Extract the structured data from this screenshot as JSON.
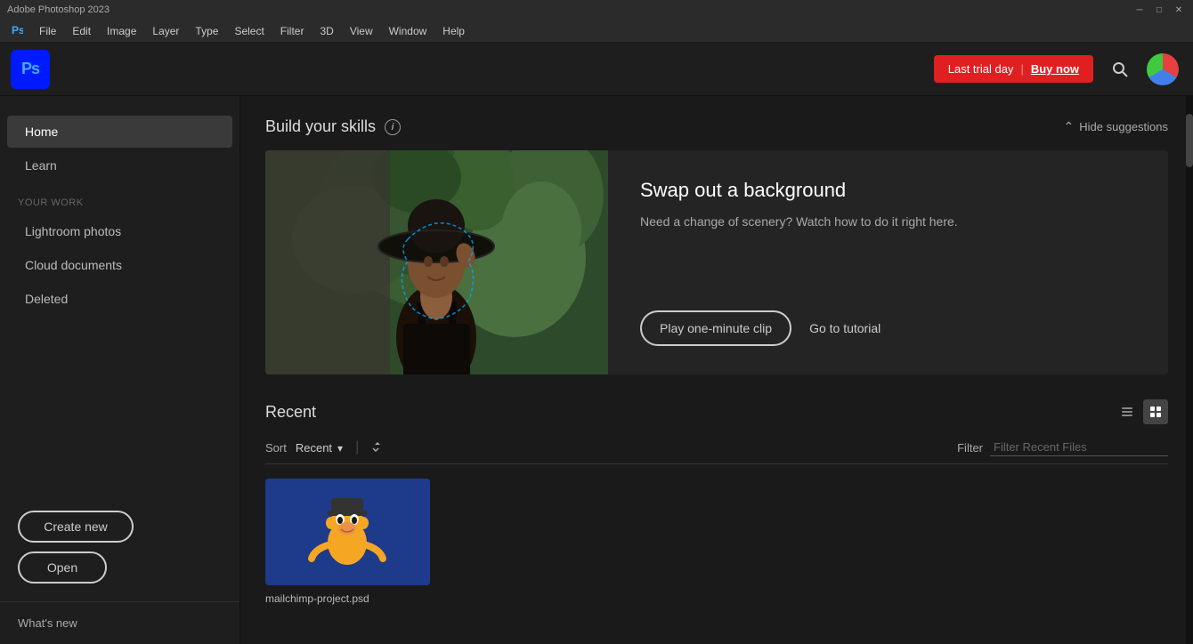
{
  "titleBar": {
    "title": "Adobe Photoshop 2023",
    "minBtn": "─",
    "maxBtn": "□",
    "closeBtn": "✕"
  },
  "menuBar": {
    "items": [
      "Ps",
      "File",
      "Edit",
      "Image",
      "Layer",
      "Type",
      "Select",
      "Filter",
      "3D",
      "View",
      "Window",
      "Help"
    ]
  },
  "header": {
    "logoText": "Ps",
    "trialText": "Last trial day",
    "separator": "|",
    "buyNow": "Buy now",
    "searchPlaceholder": "Search"
  },
  "sidebar": {
    "navItems": [
      {
        "label": "Home",
        "active": true
      },
      {
        "label": "Learn",
        "active": false
      }
    ],
    "sectionLabel": "YOUR WORK",
    "workItems": [
      {
        "label": "Lightroom photos"
      },
      {
        "label": "Cloud documents"
      },
      {
        "label": "Deleted"
      }
    ],
    "createLabel": "Create new",
    "openLabel": "Open",
    "whatsNewLabel": "What's new"
  },
  "buildSkills": {
    "title": "Build your skills",
    "infoIcon": "i",
    "hideSuggestions": "Hide suggestions",
    "card": {
      "title": "Swap out a background",
      "description": "Need a change of scenery? Watch how to do it right here.",
      "playBtn": "Play one-minute clip",
      "tutorialBtn": "Go to tutorial"
    }
  },
  "recent": {
    "title": "Recent",
    "sortLabel": "Sort",
    "sortValue": "Recent",
    "filterLabel": "Filter",
    "filterPlaceholder": "Filter Recent Files",
    "listViewIcon": "≡",
    "gridViewIcon": "⊞",
    "items": [
      {
        "name": "mailchimp-project.psd",
        "type": "psd",
        "bgColor": "#1e3a8a"
      }
    ]
  },
  "colors": {
    "accent": "#e02020",
    "buyNow": "#fff",
    "sidebarBg": "#1e1e1e",
    "contentBg": "#1a1a1a",
    "cardBg": "#242424"
  }
}
